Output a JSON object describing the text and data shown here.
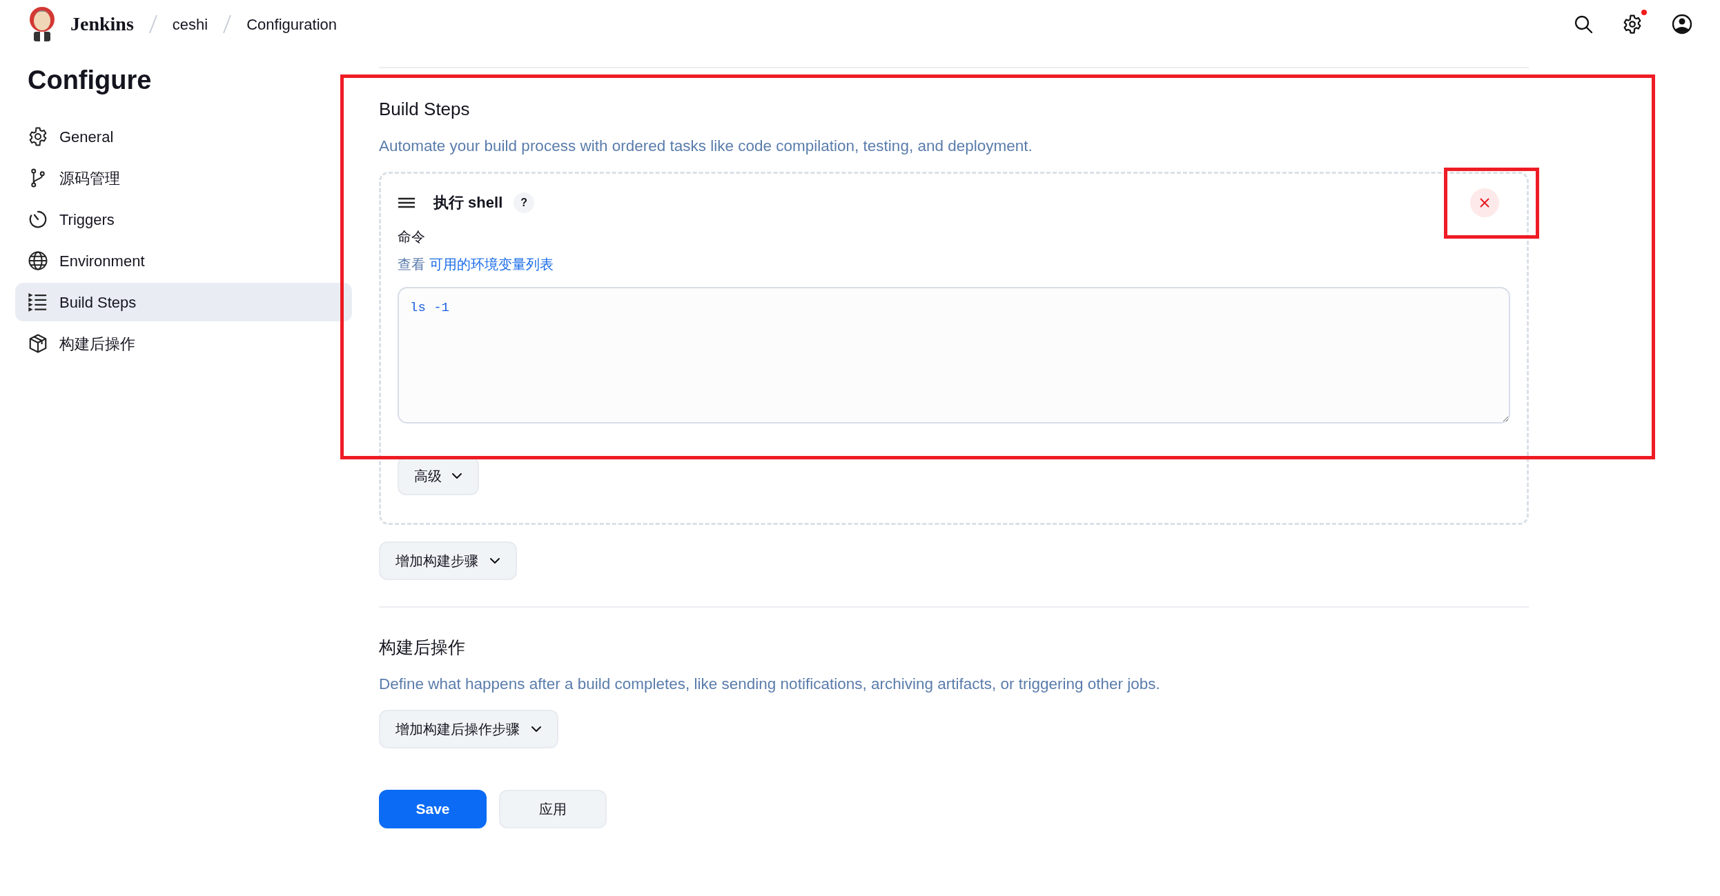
{
  "header": {
    "app_name": "Jenkins",
    "breadcrumbs": [
      "ceshi",
      "Configuration"
    ],
    "settings_alert": true
  },
  "sidebar": {
    "title": "Configure",
    "items": [
      {
        "label": "General",
        "selected": false
      },
      {
        "label": "源码管理",
        "selected": false
      },
      {
        "label": "Triggers",
        "selected": false
      },
      {
        "label": "Environment",
        "selected": false
      },
      {
        "label": "Build Steps",
        "selected": true
      },
      {
        "label": "构建后操作",
        "selected": false
      }
    ]
  },
  "build_steps": {
    "title": "Build Steps",
    "description": "Automate your build process with ordered tasks like code compilation, testing, and deployment.",
    "steps": [
      {
        "title": "执行 shell",
        "help": "?",
        "field_label": "命令",
        "hint_prefix": "查看",
        "hint_link": "可用的环境变量列表",
        "command": "ls -1",
        "advanced_button": "高级"
      }
    ],
    "add_button": "增加构建步骤"
  },
  "post_build": {
    "title": "构建后操作",
    "description": "Define what happens after a build completes, like sending notifications, archiving artifacts, or triggering other jobs.",
    "add_button": "增加构建后操作步骤"
  },
  "actions": {
    "save": "Save",
    "apply": "应用"
  },
  "highlight_frames": {
    "build_steps": true,
    "delete_button": true
  }
}
